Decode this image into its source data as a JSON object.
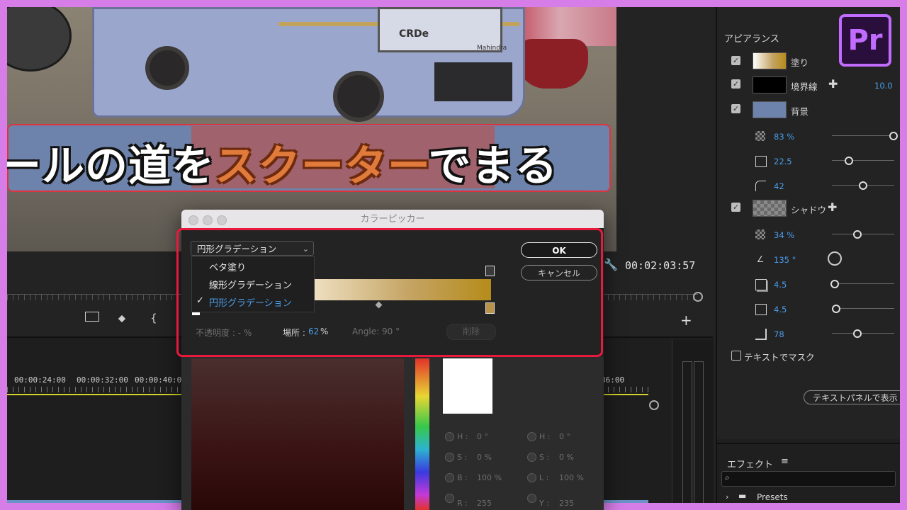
{
  "video": {
    "title_left": "ールの道を",
    "title_highlight": "スクーター",
    "title_right": "でまる",
    "bus_text": "CRDe",
    "bus_brand": "Mahindra"
  },
  "monitor": {
    "timecode": "00:02:03:57"
  },
  "timeline": {
    "ruler": [
      "00:00:24:00",
      "00:00:32:00",
      "00:00:40:00",
      "36:00"
    ]
  },
  "appearance": {
    "title": "アピアランス",
    "fill_label": "塗り",
    "stroke_label": "境界線",
    "stroke_value": "10.0",
    "background_label": "背景",
    "bg_opacity": "83 %",
    "bg_size": "22.5",
    "bg_corner": "42",
    "shadow_label": "シャドウ",
    "shadow_opacity": "34 %",
    "shadow_angle": "135 °",
    "shadow_distance": "4.5",
    "shadow_size": "4.5",
    "shadow_blur": "78",
    "mask_label": "テキストでマスク",
    "text_panel_button": "テキストパネルで表示",
    "colors": {
      "accent": "#4a9ce8",
      "fill_swatch": "#c4a362",
      "stroke_swatch": "#000000",
      "bg_swatch": "#6e83ac"
    }
  },
  "effects": {
    "title": "エフェクト",
    "search_placeholder": "",
    "item": "Presets"
  },
  "logo": {
    "text": "Pr"
  },
  "picker": {
    "title": "カラーピッカー",
    "gradient_type_selected": "円形グラデーション",
    "options": [
      "ベタ塗り",
      "線形グラデーション",
      "円形グラデーション"
    ],
    "checkmark": "✓",
    "ok": "OK",
    "cancel": "キャンセル",
    "opacity_label": "不透明度 : - %",
    "location_label": "場所 :",
    "location_value": "62",
    "location_unit": "%",
    "angle_label": "Angle: 90 °",
    "delete": "削除",
    "h1": "H :",
    "h1v": "0 °",
    "s1": "S :",
    "s1v": "0 %",
    "b1": "B :",
    "b1v": "100 %",
    "h2": "H :",
    "h2v": "0 °",
    "s2": "S :",
    "s2v": "0 %",
    "l2": "L :",
    "l2v": "100 %",
    "r": "R :",
    "rv": "255",
    "y": "Y :",
    "yv": "235"
  }
}
